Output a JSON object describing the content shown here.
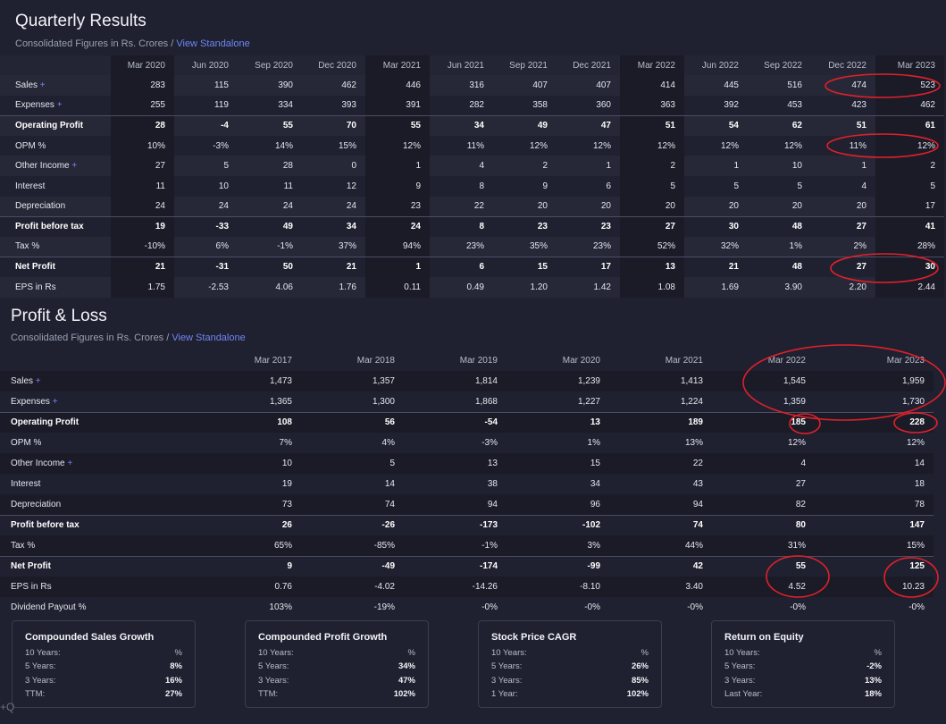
{
  "quarterly": {
    "title": "Quarterly Results",
    "subtitle": "Consolidated Figures in Rs. Crores",
    "separator": " / ",
    "link": "View Standalone",
    "columns": [
      "Mar 2020",
      "Jun 2020",
      "Sep 2020",
      "Dec 2020",
      "Mar 2021",
      "Jun 2021",
      "Sep 2021",
      "Dec 2021",
      "Mar 2022",
      "Jun 2022",
      "Sep 2022",
      "Dec 2022",
      "Mar 2023"
    ],
    "rows": [
      {
        "label": "Sales",
        "plus": "+",
        "bold": false,
        "values": [
          "283",
          "115",
          "390",
          "462",
          "446",
          "316",
          "407",
          "407",
          "414",
          "445",
          "516",
          "474",
          "523"
        ]
      },
      {
        "label": "Expenses",
        "plus": "+",
        "bold": false,
        "values": [
          "255",
          "119",
          "334",
          "393",
          "391",
          "282",
          "358",
          "360",
          "363",
          "392",
          "453",
          "423",
          "462"
        ]
      },
      {
        "label": "Operating Profit",
        "plus": "",
        "bold": true,
        "values": [
          "28",
          "-4",
          "55",
          "70",
          "55",
          "34",
          "49",
          "47",
          "51",
          "54",
          "62",
          "51",
          "61"
        ]
      },
      {
        "label": "OPM %",
        "plus": "",
        "bold": false,
        "values": [
          "10%",
          "-3%",
          "14%",
          "15%",
          "12%",
          "11%",
          "12%",
          "12%",
          "12%",
          "12%",
          "12%",
          "11%",
          "12%"
        ]
      },
      {
        "label": "Other Income",
        "plus": "+",
        "bold": false,
        "values": [
          "27",
          "5",
          "28",
          "0",
          "1",
          "4",
          "2",
          "1",
          "2",
          "1",
          "10",
          "1",
          "2"
        ]
      },
      {
        "label": "Interest",
        "plus": "",
        "bold": false,
        "values": [
          "11",
          "10",
          "11",
          "12",
          "9",
          "8",
          "9",
          "6",
          "5",
          "5",
          "5",
          "4",
          "5"
        ]
      },
      {
        "label": "Depreciation",
        "plus": "",
        "bold": false,
        "values": [
          "24",
          "24",
          "24",
          "24",
          "23",
          "22",
          "20",
          "20",
          "20",
          "20",
          "20",
          "20",
          "17"
        ]
      },
      {
        "label": "Profit before tax",
        "plus": "",
        "bold": true,
        "values": [
          "19",
          "-33",
          "49",
          "34",
          "24",
          "8",
          "23",
          "23",
          "27",
          "30",
          "48",
          "27",
          "41"
        ]
      },
      {
        "label": "Tax %",
        "plus": "",
        "bold": false,
        "values": [
          "-10%",
          "6%",
          "-1%",
          "37%",
          "94%",
          "23%",
          "35%",
          "23%",
          "52%",
          "32%",
          "1%",
          "2%",
          "28%"
        ]
      },
      {
        "label": "Net Profit",
        "plus": "",
        "bold": true,
        "values": [
          "21",
          "-31",
          "50",
          "21",
          "1",
          "6",
          "15",
          "17",
          "13",
          "21",
          "48",
          "27",
          "30"
        ]
      },
      {
        "label": "EPS in Rs",
        "plus": "",
        "bold": false,
        "values": [
          "1.75",
          "-2.53",
          "4.06",
          "1.76",
          "0.11",
          "0.49",
          "1.20",
          "1.42",
          "1.08",
          "1.69",
          "3.90",
          "2.20",
          "2.44"
        ]
      }
    ]
  },
  "profit_loss": {
    "title": "Profit & Loss",
    "subtitle": "Consolidated Figures in Rs. Crores",
    "separator": " / ",
    "link": "View Standalone",
    "columns": [
      "Mar 2017",
      "Mar 2018",
      "Mar 2019",
      "Mar 2020",
      "Mar 2021",
      "Mar 2022",
      "Mar 2023"
    ],
    "rows": [
      {
        "label": "Sales",
        "plus": "+",
        "bold": false,
        "values": [
          "1,473",
          "1,357",
          "1,814",
          "1,239",
          "1,413",
          "1,545",
          "1,959"
        ]
      },
      {
        "label": "Expenses",
        "plus": "+",
        "bold": false,
        "values": [
          "1,365",
          "1,300",
          "1,868",
          "1,227",
          "1,224",
          "1,359",
          "1,730"
        ]
      },
      {
        "label": "Operating Profit",
        "plus": "",
        "bold": true,
        "values": [
          "108",
          "56",
          "-54",
          "13",
          "189",
          "185",
          "228"
        ]
      },
      {
        "label": "OPM %",
        "plus": "",
        "bold": false,
        "values": [
          "7%",
          "4%",
          "-3%",
          "1%",
          "13%",
          "12%",
          "12%"
        ]
      },
      {
        "label": "Other Income",
        "plus": "+",
        "bold": false,
        "values": [
          "10",
          "5",
          "13",
          "15",
          "22",
          "4",
          "14"
        ]
      },
      {
        "label": "Interest",
        "plus": "",
        "bold": false,
        "values": [
          "19",
          "14",
          "38",
          "34",
          "43",
          "27",
          "18"
        ]
      },
      {
        "label": "Depreciation",
        "plus": "",
        "bold": false,
        "values": [
          "73",
          "74",
          "94",
          "96",
          "94",
          "82",
          "78"
        ]
      },
      {
        "label": "Profit before tax",
        "plus": "",
        "bold": true,
        "values": [
          "26",
          "-26",
          "-173",
          "-102",
          "74",
          "80",
          "147"
        ]
      },
      {
        "label": "Tax %",
        "plus": "",
        "bold": false,
        "values": [
          "65%",
          "-85%",
          "-1%",
          "3%",
          "44%",
          "31%",
          "15%"
        ]
      },
      {
        "label": "Net Profit",
        "plus": "",
        "bold": true,
        "values": [
          "9",
          "-49",
          "-174",
          "-99",
          "42",
          "55",
          "125"
        ]
      },
      {
        "label": "EPS in Rs",
        "plus": "",
        "bold": false,
        "values": [
          "0.76",
          "-4.02",
          "-14.26",
          "-8.10",
          "3.40",
          "4.52",
          "10.23"
        ]
      },
      {
        "label": "Dividend Payout %",
        "plus": "",
        "bold": false,
        "values": [
          "103%",
          "-19%",
          "-0%",
          "-0%",
          "-0%",
          "-0%",
          "-0%"
        ]
      }
    ]
  },
  "cards": [
    {
      "title": "Compounded Sales Growth",
      "rows": [
        [
          "10 Years:",
          "%"
        ],
        [
          "5 Years:",
          "8%"
        ],
        [
          "3 Years:",
          "16%"
        ],
        [
          "TTM:",
          "27%"
        ]
      ]
    },
    {
      "title": "Compounded Profit Growth",
      "rows": [
        [
          "10 Years:",
          "%"
        ],
        [
          "5 Years:",
          "34%"
        ],
        [
          "3 Years:",
          "47%"
        ],
        [
          "TTM:",
          "102%"
        ]
      ]
    },
    {
      "title": "Stock Price CAGR",
      "rows": [
        [
          "10 Years:",
          "%"
        ],
        [
          "5 Years:",
          "26%"
        ],
        [
          "3 Years:",
          "85%"
        ],
        [
          "1 Year:",
          "102%"
        ]
      ]
    },
    {
      "title": "Return on Equity",
      "rows": [
        [
          "10 Years:",
          "%"
        ],
        [
          "5 Years:",
          "-2%"
        ],
        [
          "3 Years:",
          "13%"
        ],
        [
          "Last Year:",
          "18%"
        ]
      ]
    }
  ],
  "watermark": "+Q",
  "colors": {
    "background": "#1f2130",
    "accent": "#6f86f5",
    "annotation": "#e0202a"
  }
}
